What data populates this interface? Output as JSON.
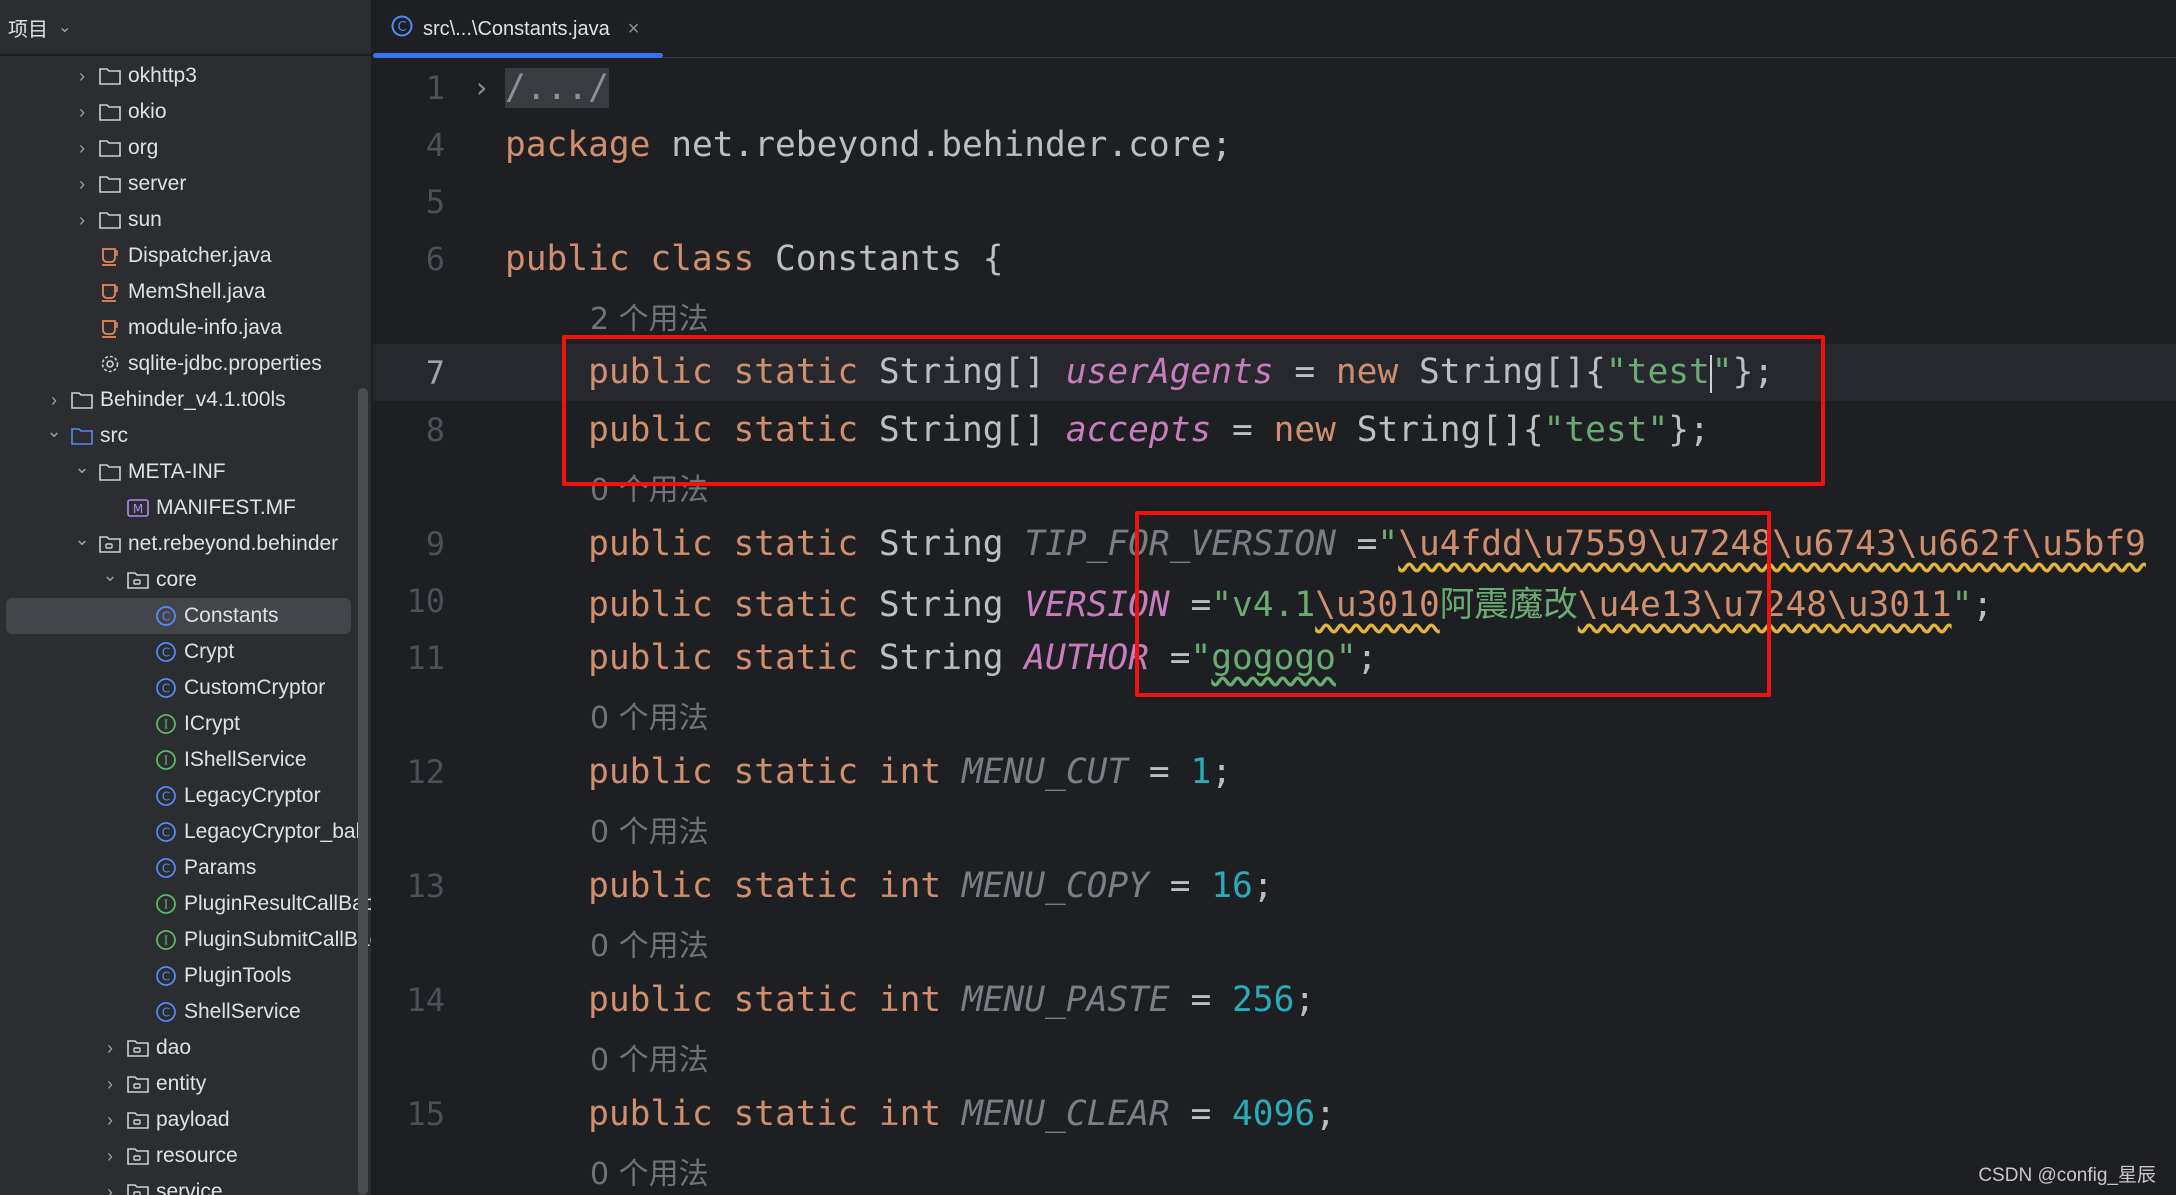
{
  "sidebar": {
    "title": "项目",
    "items": [
      {
        "label": "okhttp3",
        "level": 1,
        "chevron": "right",
        "icon": "folder-icon"
      },
      {
        "label": "okio",
        "level": 1,
        "chevron": "right",
        "icon": "folder-icon"
      },
      {
        "label": "org",
        "level": 1,
        "chevron": "right",
        "icon": "folder-icon"
      },
      {
        "label": "server",
        "level": 1,
        "chevron": "right",
        "icon": "folder-icon"
      },
      {
        "label": "sun",
        "level": 1,
        "chevron": "right",
        "icon": "folder-icon"
      },
      {
        "label": "Dispatcher.java",
        "level": 1,
        "chevron": "",
        "icon": "java-file-icon"
      },
      {
        "label": "MemShell.java",
        "level": 1,
        "chevron": "",
        "icon": "java-file-icon"
      },
      {
        "label": "module-info.java",
        "level": 1,
        "chevron": "",
        "icon": "java-file-icon"
      },
      {
        "label": "sqlite-jdbc.properties",
        "level": 1,
        "chevron": "",
        "icon": "gear-icon"
      },
      {
        "label": "Behinder_v4.1.t00ls",
        "level": 0,
        "chevron": "right",
        "icon": "folder-icon"
      },
      {
        "label": "src",
        "level": 0,
        "chevron": "down",
        "icon": "source-folder-icon"
      },
      {
        "label": "META-INF",
        "level": 1,
        "chevron": "down",
        "icon": "folder-icon"
      },
      {
        "label": "MANIFEST.MF",
        "level": 2,
        "chevron": "",
        "icon": "manifest-icon"
      },
      {
        "label": "net.rebeyond.behinder",
        "level": 1,
        "chevron": "down",
        "icon": "package-icon"
      },
      {
        "label": "core",
        "level": 2,
        "chevron": "down",
        "icon": "package-icon"
      },
      {
        "label": "Constants",
        "level": 3,
        "chevron": "",
        "icon": "class-icon",
        "selected": true
      },
      {
        "label": "Crypt",
        "level": 3,
        "chevron": "",
        "icon": "class-icon"
      },
      {
        "label": "CustomCryptor",
        "level": 3,
        "chevron": "",
        "icon": "class-icon"
      },
      {
        "label": "ICrypt",
        "level": 3,
        "chevron": "",
        "icon": "interface-icon"
      },
      {
        "label": "IShellService",
        "level": 3,
        "chevron": "",
        "icon": "interface-icon"
      },
      {
        "label": "LegacyCryptor",
        "level": 3,
        "chevron": "",
        "icon": "class-icon"
      },
      {
        "label": "LegacyCryptor_bak",
        "level": 3,
        "chevron": "",
        "icon": "class-icon"
      },
      {
        "label": "Params",
        "level": 3,
        "chevron": "",
        "icon": "class-icon"
      },
      {
        "label": "PluginResultCallBack",
        "level": 3,
        "chevron": "",
        "icon": "interface-icon"
      },
      {
        "label": "PluginSubmitCallBack",
        "level": 3,
        "chevron": "",
        "icon": "interface-icon"
      },
      {
        "label": "PluginTools",
        "level": 3,
        "chevron": "",
        "icon": "class-icon"
      },
      {
        "label": "ShellService",
        "level": 3,
        "chevron": "",
        "icon": "class-icon"
      },
      {
        "label": "dao",
        "level": 2,
        "chevron": "right",
        "icon": "package-icon"
      },
      {
        "label": "entity",
        "level": 2,
        "chevron": "right",
        "icon": "package-icon"
      },
      {
        "label": "payload",
        "level": 2,
        "chevron": "right",
        "icon": "package-icon"
      },
      {
        "label": "resource",
        "level": 2,
        "chevron": "right",
        "icon": "package-icon"
      },
      {
        "label": "service",
        "level": 2,
        "chevron": "right",
        "icon": "package-icon"
      }
    ]
  },
  "tab": {
    "label": "src\\...\\Constants.java",
    "icon": "class-icon",
    "close": "×"
  },
  "colors": {
    "keyword": "#cf8e6d",
    "string": "#6aab73",
    "field": "#c77dbb",
    "number": "#2aacb8",
    "highlight_box": "#f0120f",
    "accent": "#3574f0"
  },
  "code": [
    {
      "num": "1",
      "fold": "›",
      "tokens": [
        [
          "fold",
          "/.../"
        ]
      ]
    },
    {
      "num": "4",
      "tokens": [
        [
          "kw",
          "package"
        ],
        [
          "",
          "net.rebeyond.behinder.core;"
        ]
      ]
    },
    {
      "num": "5",
      "tokens": []
    },
    {
      "num": "6",
      "tokens": [
        [
          "kw",
          "public class"
        ],
        [
          "",
          "Constants {"
        ]
      ]
    },
    {
      "hint": "2 个用法"
    },
    {
      "num": "7",
      "current": true,
      "tokens": [
        [
          "kw",
          "    public static"
        ],
        [
          "",
          "String[]"
        ],
        [
          "field",
          "userAgents"
        ],
        [
          "",
          "="
        ],
        [
          "kw",
          "new"
        ],
        [
          "",
          "String[]{"
        ],
        [
          "str",
          "\"test"
        ],
        [
          "caret",
          ""
        ],
        [
          "str",
          "\""
        ],
        [
          "",
          "};"
        ]
      ]
    },
    {
      "num": "8",
      "tokens": [
        [
          "kw",
          "    public static"
        ],
        [
          "",
          "String[]"
        ],
        [
          "field",
          "accepts"
        ],
        [
          "",
          "="
        ],
        [
          "kw",
          "new"
        ],
        [
          "",
          "String[]{"
        ],
        [
          "str",
          "\"test\""
        ],
        [
          "",
          "};"
        ]
      ]
    },
    {
      "hint": "0 个用法"
    },
    {
      "num": "9",
      "tokens": [
        [
          "kw",
          "    public static"
        ],
        [
          "",
          "String"
        ],
        [
          "unused",
          "TIP_FOR_VERSION"
        ],
        [
          "",
          "="
        ],
        [
          "str",
          "\""
        ],
        [
          "escw",
          "\\u4fdd\\u7559\\u7248\\u6743\\u662f\\u5bf9"
        ]
      ]
    },
    {
      "num": "10",
      "tokens": [
        [
          "kw",
          "    public static"
        ],
        [
          "",
          "String"
        ],
        [
          "field",
          "VERSION"
        ],
        [
          "",
          "="
        ],
        [
          "str",
          "\"v4.1"
        ],
        [
          "escw",
          "\\u3010"
        ],
        [
          "strcjk",
          "阿震魔改"
        ],
        [
          "escw",
          "\\u4e13\\u7248\\u3011"
        ],
        [
          "str",
          "\""
        ],
        [
          "",
          ";"
        ]
      ]
    },
    {
      "num": "11",
      "tokens": [
        [
          "kw",
          "    public static"
        ],
        [
          "",
          "String"
        ],
        [
          "field",
          "AUTHOR"
        ],
        [
          "",
          "="
        ],
        [
          "str",
          "\""
        ],
        [
          "strw",
          "gogogo"
        ],
        [
          "str",
          "\""
        ],
        [
          "",
          ";"
        ]
      ]
    },
    {
      "hint": "0 个用法"
    },
    {
      "num": "12",
      "tokens": [
        [
          "kw",
          "    public static int"
        ],
        [
          "unused",
          "MENU_CUT"
        ],
        [
          "",
          "="
        ],
        [
          "num",
          "1"
        ],
        [
          "",
          ";"
        ]
      ]
    },
    {
      "hint": "0 个用法"
    },
    {
      "num": "13",
      "tokens": [
        [
          "kw",
          "    public static int"
        ],
        [
          "unused",
          "MENU_COPY"
        ],
        [
          "",
          "="
        ],
        [
          "num",
          "16"
        ],
        [
          "",
          ";"
        ]
      ]
    },
    {
      "hint": "0 个用法"
    },
    {
      "num": "14",
      "tokens": [
        [
          "kw",
          "    public static int"
        ],
        [
          "unused",
          "MENU_PASTE"
        ],
        [
          "",
          "="
        ],
        [
          "num",
          "256"
        ],
        [
          "",
          ";"
        ]
      ]
    },
    {
      "hint": "0 个用法"
    },
    {
      "num": "15",
      "tokens": [
        [
          "kw",
          "    public static int"
        ],
        [
          "unused",
          "MENU_CLEAR"
        ],
        [
          "",
          "="
        ],
        [
          "num",
          "4096"
        ],
        [
          "",
          ";"
        ]
      ]
    },
    {
      "hint": "0 个用法"
    }
  ],
  "watermark": "CSDN @config_星辰"
}
